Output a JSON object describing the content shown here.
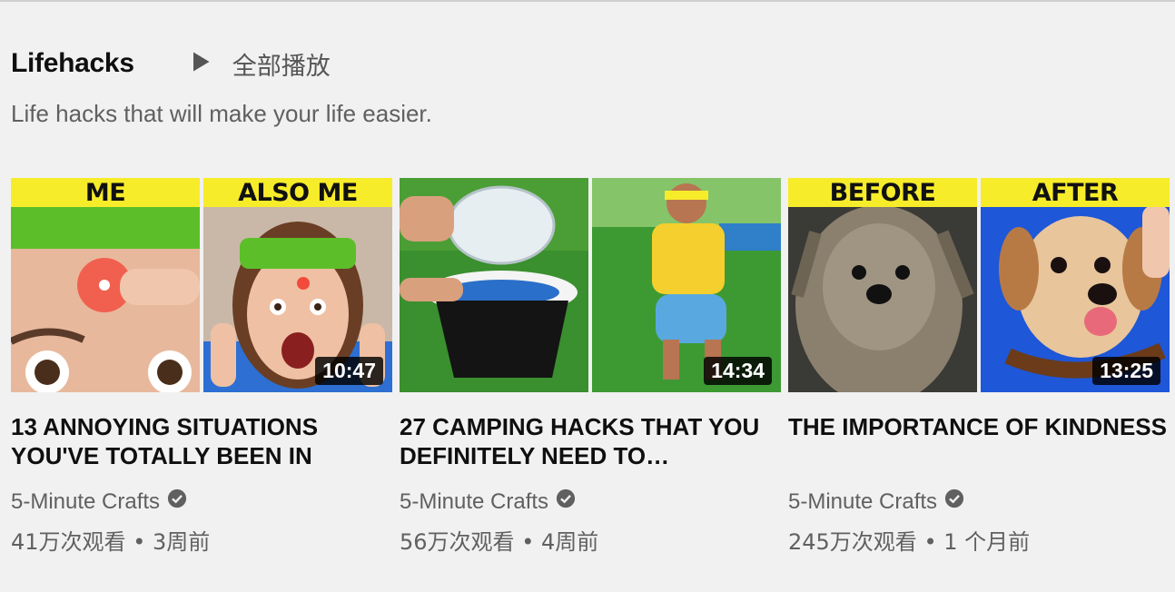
{
  "shelf": {
    "title": "Lifehacks",
    "play_all_label": "全部播放",
    "description": "Life hacks that will make your life easier."
  },
  "videos": [
    {
      "left_banner": "ME",
      "right_banner": "ALSO ME",
      "duration": "10:47",
      "title": "13 ANNOYING SITUATIONS YOU'VE TOTALLY BEEN IN",
      "channel": "5-Minute Crafts",
      "views": "41万次观看",
      "age": "3周前"
    },
    {
      "left_banner": "",
      "right_banner": "",
      "duration": "14:34",
      "title": "27 CAMPING HACKS THAT YOU DEFINITELY NEED TO…",
      "channel": "5-Minute Crafts",
      "views": "56万次观看",
      "age": "4周前"
    },
    {
      "left_banner": "BEFORE",
      "right_banner": "AFTER",
      "duration": "13:25",
      "title": "THE IMPORTANCE OF KINDNESS",
      "channel": "5-Minute Crafts",
      "views": "245万次观看",
      "age": "1 个月前"
    }
  ],
  "meta_separator": "•",
  "colors": {
    "banner": "#f7ec2a",
    "headband_green": "#5cbf2a",
    "grass": "#2f8a2a",
    "blue_bg": "#1e57d8"
  }
}
